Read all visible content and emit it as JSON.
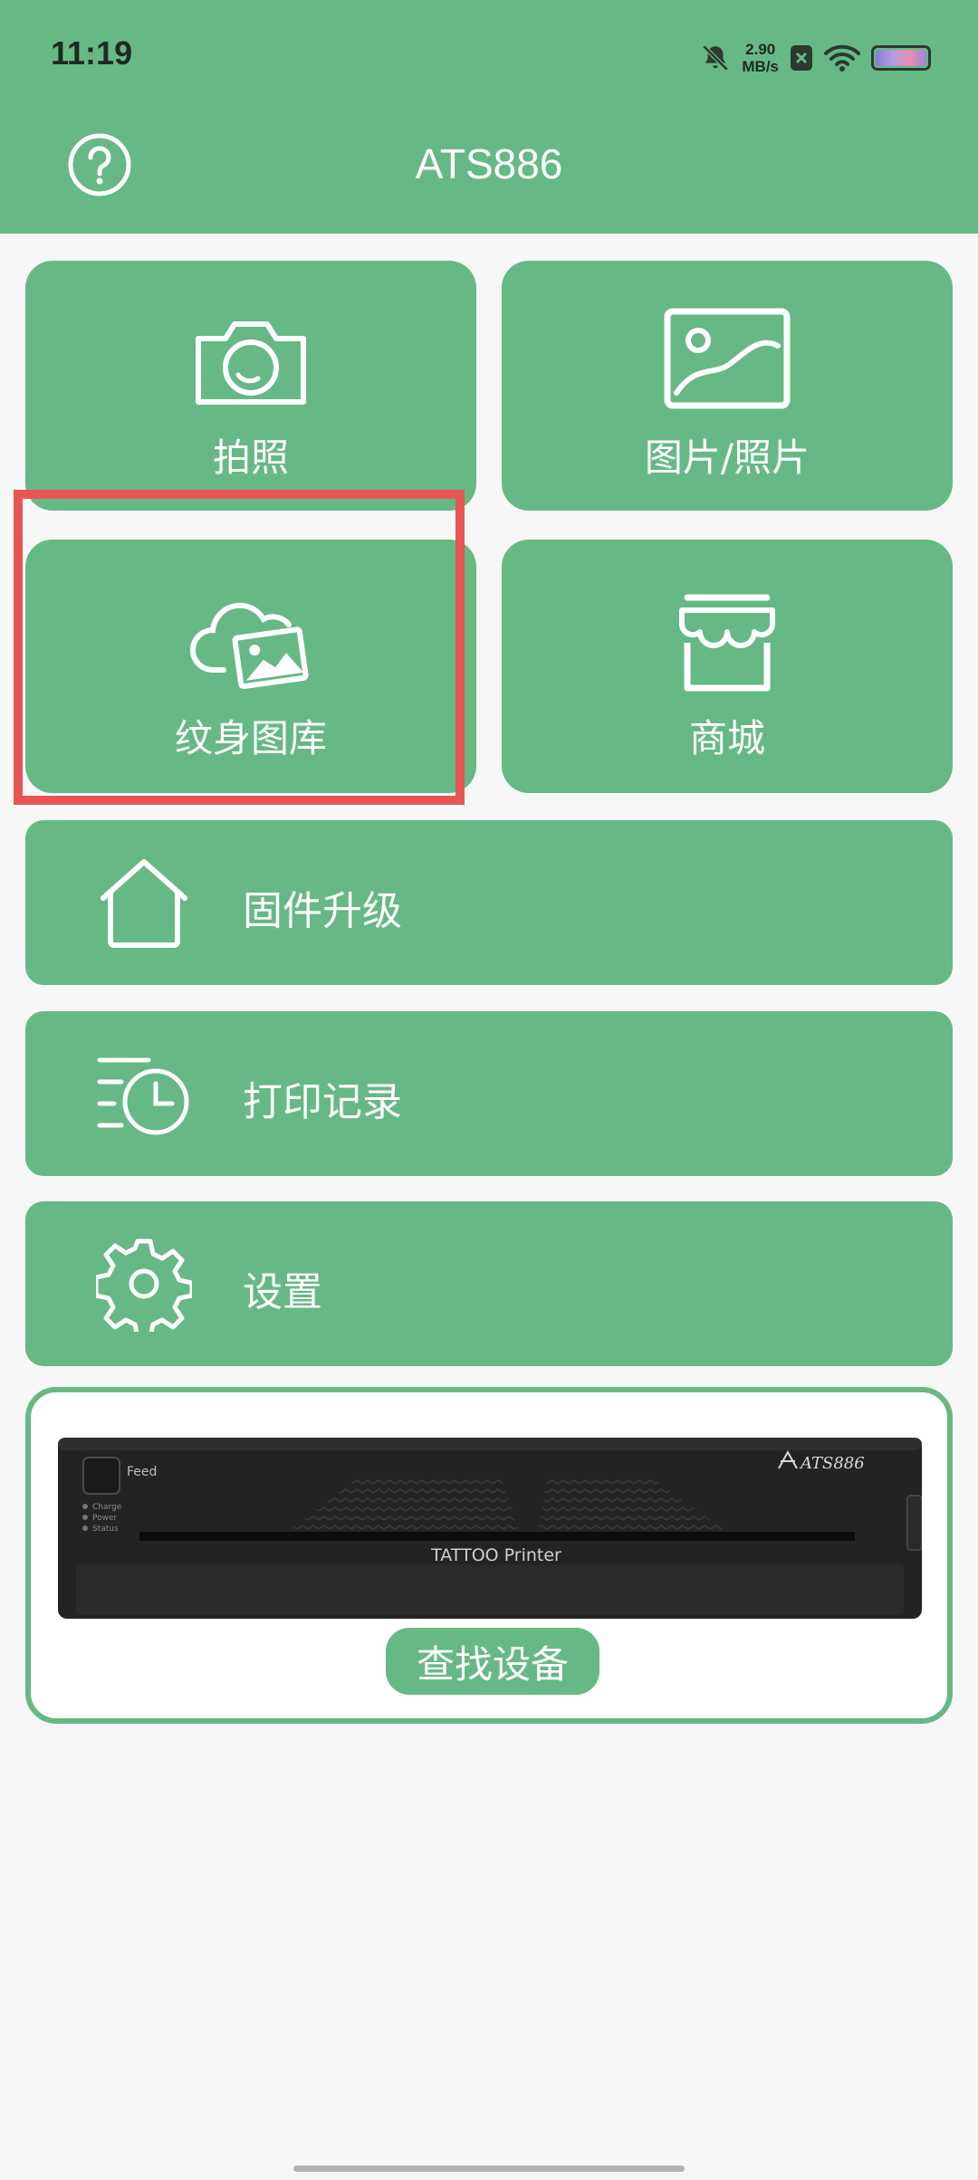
{
  "status_bar": {
    "time": "11:19",
    "net_speed_value": "2.90",
    "net_speed_unit": "MB/s",
    "icons": [
      "mute-bell-icon",
      "notification-x-icon",
      "wifi-icon",
      "battery-icon"
    ]
  },
  "header": {
    "title": "ATS886",
    "help_icon": "question-circle-icon"
  },
  "tiles": [
    {
      "label": "拍照",
      "icon": "camera-icon"
    },
    {
      "label": "图片/照片",
      "icon": "image-icon"
    },
    {
      "label": "纹身图库",
      "icon": "cloud-gallery-icon"
    },
    {
      "label": "商城",
      "icon": "store-icon"
    }
  ],
  "menu": [
    {
      "label": "固件升级",
      "icon": "house-icon"
    },
    {
      "label": "打印记录",
      "icon": "history-clock-icon"
    },
    {
      "label": "设置",
      "icon": "gear-icon"
    }
  ],
  "device": {
    "feed_label": "Feed",
    "indicators": [
      "Charge",
      "Power",
      "Status"
    ],
    "brand": "ATS886",
    "model": "TATTOO Printer",
    "find_button": "查找设备"
  },
  "colors": {
    "primary": "#66b984",
    "highlight": "#e85555",
    "background": "#f7f7f7"
  }
}
